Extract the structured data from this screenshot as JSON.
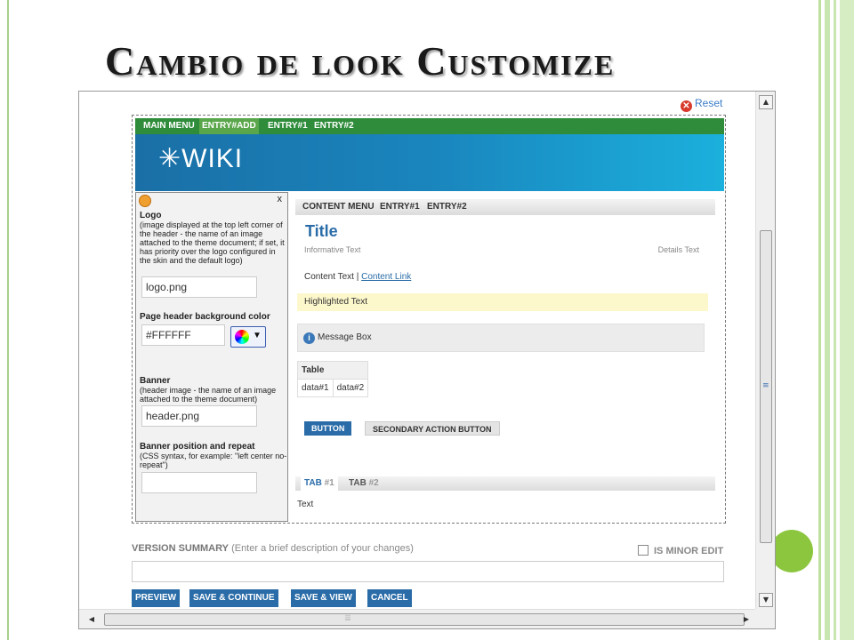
{
  "slide": {
    "title": "Cambio de look Customize"
  },
  "toolbar": {
    "reset_label": "Reset"
  },
  "main_menu": {
    "items": [
      "MAIN MENU",
      "ENTRY#ADD",
      "ENTRY#1",
      "ENTRY#2"
    ]
  },
  "logo": {
    "text": "✳WIKI"
  },
  "panel": {
    "close_label": "x",
    "logo_label": "Logo",
    "logo_help": "(image displayed at the top left corner of the header - the name of an image attached to the theme document; if set, it has priority over the logo configured in the skin and the default logo)",
    "logo_value": "logo.png",
    "header_bg_label": "Page header background color",
    "header_bg_value": "#FFFFFF",
    "banner_label": "Banner",
    "banner_help": "(header image - the name of an image attached to the theme document)",
    "banner_value": "header.png",
    "banner_pos_label": "Banner position and repeat",
    "banner_pos_help": "(CSS syntax, for example: \"left center no-repeat\")",
    "banner_pos_value": ""
  },
  "content": {
    "menu_items": [
      "CONTENT MENU",
      "ENTRY#1",
      "ENTRY#2"
    ],
    "title": "Title",
    "informative_text": "Informative Text",
    "details_text": "Details Text",
    "content_text": "Content Text |",
    "content_link": "Content Link",
    "highlighted_text": "Highlighted Text",
    "message_box": "Message Box",
    "table": {
      "header": "Table",
      "cells": [
        "data#1",
        "data#2"
      ]
    },
    "button_primary": "BUTTON",
    "button_secondary": "SECONDARY ACTION BUTTON"
  },
  "tabs": {
    "items": [
      {
        "label": "TAB",
        "num": "#1"
      },
      {
        "label": "TAB",
        "num": "#2"
      }
    ],
    "text": "Text"
  },
  "version_summary": {
    "label": "VERSION SUMMARY",
    "hint": "(Enter a brief description of your changes)",
    "minor_edit_label": "IS MINOR EDIT"
  },
  "actions": [
    "PREVIEW",
    "SAVE & CONTINUE",
    "SAVE & VIEW",
    "CANCEL"
  ],
  "colors": {
    "menu_green": "#2e8c3a",
    "header_blue": "#1a85bd",
    "link_blue": "#2a6ca8",
    "accent_dot": "#8cc63f"
  }
}
